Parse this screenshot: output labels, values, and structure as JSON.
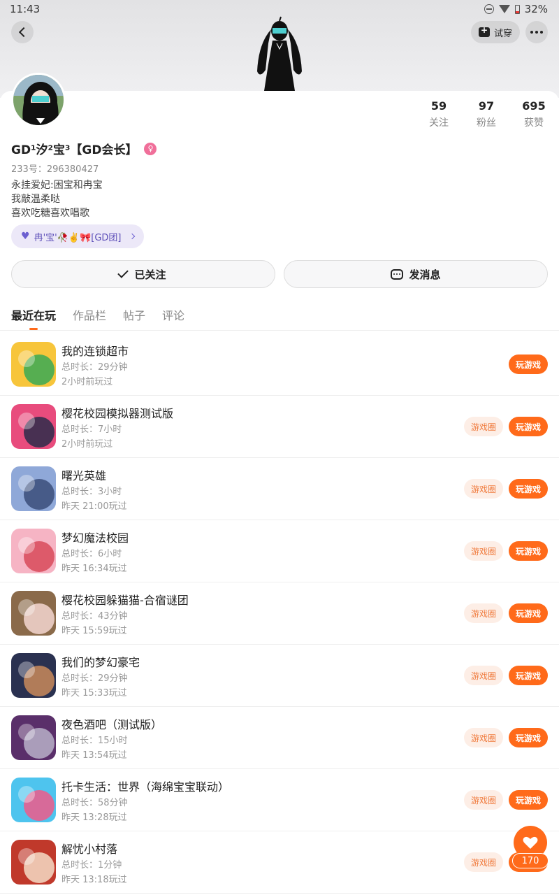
{
  "status_bar": {
    "time": "11:43",
    "battery": "32%"
  },
  "header": {
    "tryon_label": "试穿"
  },
  "profile": {
    "name": "GD¹汐²宝³【GD会长】",
    "uid": "233号：296380427",
    "bio": [
      "永挂爱妃:困宝和冉宝",
      "我敲温柔哒",
      "喜欢吃糖喜欢唱歌"
    ],
    "club": "冉'宝'🥀✌️🎀[GD团]",
    "stats": [
      {
        "num": "59",
        "label": "关注"
      },
      {
        "num": "97",
        "label": "粉丝"
      },
      {
        "num": "695",
        "label": "获赞"
      }
    ]
  },
  "actions": {
    "follow_label": "已关注",
    "message_label": "发消息"
  },
  "tabs": [
    "最近在玩",
    "作品栏",
    "帖子",
    "评论"
  ],
  "button_labels": {
    "circle": "游戏圈",
    "play": "玩游戏"
  },
  "games": [
    {
      "title": "我的连锁超市",
      "duration": "总时长：29分钟",
      "last_played": "2小时前玩过",
      "has_circle": false,
      "icon_colors": [
        "#f7c53b",
        "#3aa956"
      ]
    },
    {
      "title": "樱花校园模拟器测试版",
      "duration": "总时长：7小时",
      "last_played": "2小时前玩过",
      "has_circle": true,
      "icon_colors": [
        "#e84c7d",
        "#2b2b4a"
      ]
    },
    {
      "title": "曙光英雄",
      "duration": "总时长：3小时",
      "last_played": "昨天 21:00玩过",
      "has_circle": true,
      "icon_colors": [
        "#8fa8d8",
        "#3b4d7a"
      ]
    },
    {
      "title": "梦幻魔法校园",
      "duration": "总时长：6小时",
      "last_played": "昨天 16:34玩过",
      "has_circle": true,
      "icon_colors": [
        "#f6b4c4",
        "#d84a5a"
      ]
    },
    {
      "title": "樱花校园躲猫猫-合宿谜团",
      "duration": "总时长：43分钟",
      "last_played": "昨天 15:59玩过",
      "has_circle": true,
      "icon_colors": [
        "#8a6a4a",
        "#f3d6d0"
      ]
    },
    {
      "title": "我们的梦幻豪宅",
      "duration": "总时长：29分钟",
      "last_played": "昨天 15:33玩过",
      "has_circle": true,
      "icon_colors": [
        "#2a3150",
        "#c98a5a"
      ]
    },
    {
      "title": "夜色酒吧（测试版）",
      "duration": "总时长：15小时",
      "last_played": "昨天 13:54玩过",
      "has_circle": true,
      "icon_colors": [
        "#5a2f6a",
        "#b9b0c8"
      ]
    },
    {
      "title": "托卡生活：世界（海绵宝宝联动）",
      "duration": "总时长：58分钟",
      "last_played": "昨天 13:28玩过",
      "has_circle": true,
      "icon_colors": [
        "#4ec4ee",
        "#f05b8a"
      ]
    },
    {
      "title": "解忧小村落",
      "duration": "总时长：1分钟",
      "last_played": "昨天 13:18玩过",
      "has_circle": true,
      "icon_colors": [
        "#c0392b",
        "#f4dcc6"
      ]
    }
  ],
  "like": {
    "count": "170"
  },
  "colors": {
    "accent": "#ff6a1a",
    "circle_bg": "#fdeee6"
  }
}
